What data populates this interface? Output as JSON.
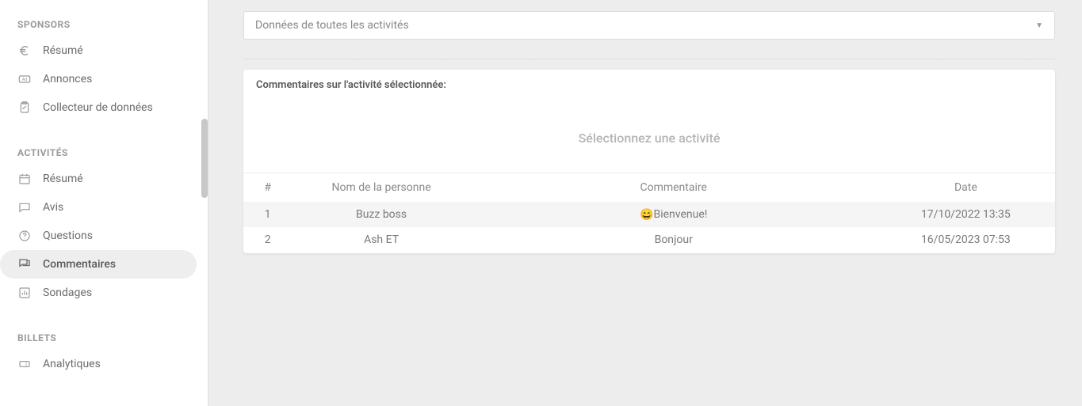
{
  "sidebar": {
    "sections": [
      {
        "key": "sponsors",
        "title": "SPONSORS",
        "items": [
          {
            "key": "resume-sponsors",
            "label": "Résumé",
            "icon": "euro-icon"
          },
          {
            "key": "annonces",
            "label": "Annonces",
            "icon": "ad-icon"
          },
          {
            "key": "collecteur",
            "label": "Collecteur de données",
            "icon": "clipboard-icon"
          }
        ]
      },
      {
        "key": "activites",
        "title": "ACTIVITÉS",
        "items": [
          {
            "key": "resume-activites",
            "label": "Résumé",
            "icon": "calendar-icon"
          },
          {
            "key": "avis",
            "label": "Avis",
            "icon": "speech-icon"
          },
          {
            "key": "questions",
            "label": "Questions",
            "icon": "question-icon"
          },
          {
            "key": "commentaires",
            "label": "Commentaires",
            "icon": "comments-icon",
            "active": true
          },
          {
            "key": "sondages",
            "label": "Sondages",
            "icon": "poll-icon"
          }
        ]
      },
      {
        "key": "billets",
        "title": "BILLETS",
        "items": [
          {
            "key": "analytiques",
            "label": "Analytiques",
            "icon": "ticket-icon"
          }
        ]
      }
    ]
  },
  "main": {
    "select_label": "Données de toutes les activités",
    "card": {
      "title": "Commentaires sur l'activité sélectionnée:",
      "hint": "Sélectionnez une activité",
      "columns": {
        "idx": "#",
        "name": "Nom de la personne",
        "comment": "Commentaire",
        "date": "Date"
      },
      "rows": [
        {
          "idx": "1",
          "name": "Buzz boss",
          "emoji": "😄",
          "comment": "Bienvenue!",
          "date": "17/10/2022 13:35"
        },
        {
          "idx": "2",
          "name": "Ash ET",
          "emoji": "",
          "comment": "Bonjour",
          "date": "16/05/2023 07:53"
        }
      ]
    }
  }
}
